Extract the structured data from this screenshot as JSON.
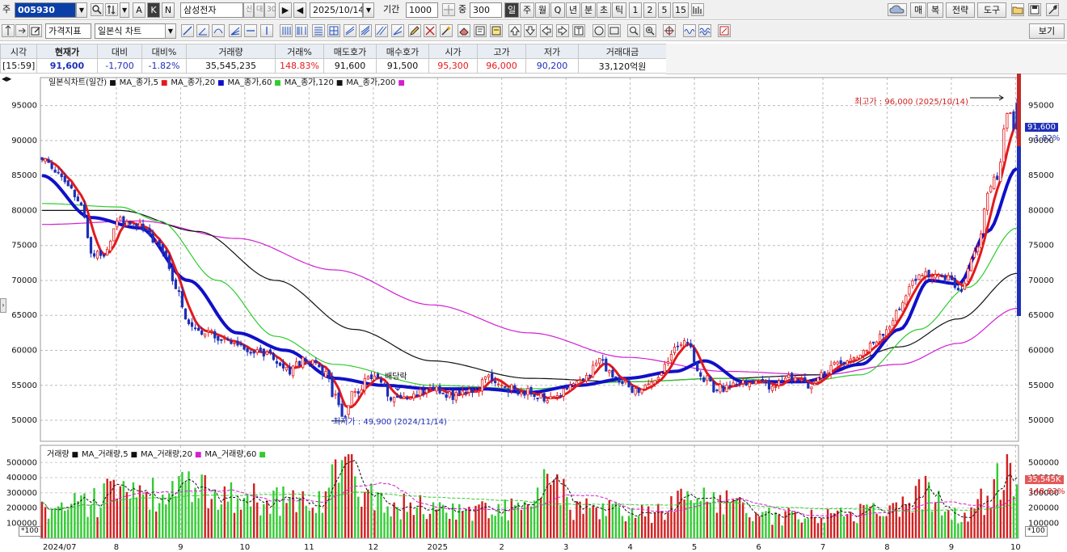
{
  "toolbar1": {
    "market_label": "주",
    "code": "005930",
    "mode_buttons": [
      "A",
      "K",
      "N"
    ],
    "stock_name": "삼성전자",
    "name_tags": [
      "신",
      "대",
      "30"
    ],
    "date": "2025/10/14",
    "period_label": "기간",
    "period_value": "1000",
    "count_label": "중",
    "count_value": "300",
    "interval_buttons": [
      "일",
      "주",
      "월",
      "Q",
      "년",
      "분",
      "초",
      "틱",
      "1",
      "2",
      "5",
      "15"
    ],
    "right_buttons": [
      "매",
      "복",
      "전략",
      "도구"
    ]
  },
  "toolbar2": {
    "indicator_select": "가격지표",
    "chart_type_select": "일본식 차트",
    "view_button": "보기"
  },
  "quote": {
    "headers": [
      "시각",
      "현재가",
      "대비",
      "대비%",
      "거래량",
      "거래%",
      "매도호가",
      "매수호가",
      "시가",
      "고가",
      "저가",
      "거래대금"
    ],
    "values": [
      "[15:59]",
      "91,600",
      "-1,700",
      "-1.82%",
      "35,545,235",
      "148.83%",
      "91,600",
      "91,500",
      "95,300",
      "96,000",
      "90,200",
      "33,120억원"
    ]
  },
  "colors": {
    "up": "#e31a1c",
    "down": "#1f2fb8",
    "ma5": "#e31a1c",
    "ma20": "#1010c8",
    "ma60": "#2ecc2e",
    "ma120": "#111111",
    "ma200": "#d21fd2",
    "vol_up": "#d22020",
    "vol_down": "#33cc33"
  },
  "price_panel": {
    "legend": [
      {
        "label": "일본식차트(일간)",
        "color": "#111111"
      },
      {
        "label": "MA_종가,5",
        "color": "#e31a1c"
      },
      {
        "label": "MA_종가,20",
        "color": "#1010c8"
      },
      {
        "label": "MA_종가,60",
        "color": "#2ecc2e"
      },
      {
        "label": "MA_종가,120",
        "color": "#111111"
      },
      {
        "label": "MA_종가,200",
        "color": "#d21fd2"
      }
    ],
    "high_note": "최고가 : 96,000 (2025/10/14)",
    "low_note": "최저가 : 49,900 (2024/11/14)",
    "dividend_note": "배당락",
    "current_price": "91,600",
    "current_pct": "-1.82%"
  },
  "volume_panel": {
    "legend": [
      {
        "label": "거래량",
        "color": "#111111"
      },
      {
        "label": "MA_거래량,5",
        "color": "#111111"
      },
      {
        "label": "MA_거래량,20",
        "color": "#d21fd2"
      },
      {
        "label": "MA_거래량,60",
        "color": "#2ecc2e"
      }
    ],
    "current_volume": "35,545K",
    "current_pct": "148.83%",
    "scale": "*100"
  },
  "chart_data": [
    {
      "type": "candlestick",
      "title": "일본식차트(일간)",
      "x_labels": [
        "2024/07",
        "8",
        "9",
        "10",
        "11",
        "12",
        "2025",
        "2",
        "3",
        "4",
        "5",
        "6",
        "7",
        "8",
        "9",
        "10"
      ],
      "ylim": [
        47000,
        99000
      ],
      "y_ticks": [
        50000,
        55000,
        60000,
        65000,
        70000,
        75000,
        80000,
        85000,
        90000,
        95000
      ],
      "grid": true,
      "close_keypoints": [
        {
          "t": 0.0,
          "v": 87000
        },
        {
          "t": 0.02,
          "v": 85000
        },
        {
          "t": 0.04,
          "v": 81000
        },
        {
          "t": 0.05,
          "v": 74000
        },
        {
          "t": 0.06,
          "v": 73500
        },
        {
          "t": 0.08,
          "v": 78500
        },
        {
          "t": 0.1,
          "v": 78000
        },
        {
          "t": 0.12,
          "v": 75000
        },
        {
          "t": 0.14,
          "v": 68000
        },
        {
          "t": 0.15,
          "v": 64000
        },
        {
          "t": 0.17,
          "v": 62500
        },
        {
          "t": 0.19,
          "v": 61000
        },
        {
          "t": 0.21,
          "v": 60000
        },
        {
          "t": 0.23,
          "v": 59500
        },
        {
          "t": 0.25,
          "v": 57000
        },
        {
          "t": 0.27,
          "v": 58500
        },
        {
          "t": 0.29,
          "v": 57000
        },
        {
          "t": 0.3,
          "v": 53500
        },
        {
          "t": 0.31,
          "v": 50500
        },
        {
          "t": 0.32,
          "v": 54000
        },
        {
          "t": 0.34,
          "v": 56500
        },
        {
          "t": 0.36,
          "v": 53000
        },
        {
          "t": 0.38,
          "v": 53500
        },
        {
          "t": 0.4,
          "v": 55000
        },
        {
          "t": 0.42,
          "v": 53500
        },
        {
          "t": 0.44,
          "v": 54000
        },
        {
          "t": 0.46,
          "v": 56000
        },
        {
          "t": 0.48,
          "v": 54500
        },
        {
          "t": 0.5,
          "v": 54000
        },
        {
          "t": 0.52,
          "v": 53000
        },
        {
          "t": 0.54,
          "v": 54500
        },
        {
          "t": 0.56,
          "v": 56500
        },
        {
          "t": 0.57,
          "v": 58500
        },
        {
          "t": 0.59,
          "v": 56000
        },
        {
          "t": 0.61,
          "v": 54000
        },
        {
          "t": 0.63,
          "v": 56000
        },
        {
          "t": 0.65,
          "v": 60500
        },
        {
          "t": 0.66,
          "v": 61000
        },
        {
          "t": 0.68,
          "v": 56000
        },
        {
          "t": 0.69,
          "v": 54500
        },
        {
          "t": 0.71,
          "v": 55000
        },
        {
          "t": 0.73,
          "v": 55500
        },
        {
          "t": 0.75,
          "v": 55000
        },
        {
          "t": 0.77,
          "v": 56000
        },
        {
          "t": 0.79,
          "v": 55000
        },
        {
          "t": 0.8,
          "v": 56500
        },
        {
          "t": 0.82,
          "v": 58500
        },
        {
          "t": 0.84,
          "v": 59500
        },
        {
          "t": 0.86,
          "v": 62000
        },
        {
          "t": 0.88,
          "v": 65500
        },
        {
          "t": 0.89,
          "v": 69500
        },
        {
          "t": 0.91,
          "v": 71000
        },
        {
          "t": 0.93,
          "v": 70500
        },
        {
          "t": 0.94,
          "v": 68500
        },
        {
          "t": 0.96,
          "v": 75000
        },
        {
          "t": 0.97,
          "v": 83000
        },
        {
          "t": 0.98,
          "v": 85000
        },
        {
          "t": 0.99,
          "v": 94000
        },
        {
          "t": 1.0,
          "v": 91600
        }
      ],
      "ma20_keypoints": [
        {
          "t": 0.0,
          "v": 85000
        },
        {
          "t": 0.05,
          "v": 79000
        },
        {
          "t": 0.1,
          "v": 77500
        },
        {
          "t": 0.15,
          "v": 70000
        },
        {
          "t": 0.2,
          "v": 62500
        },
        {
          "t": 0.25,
          "v": 60000
        },
        {
          "t": 0.3,
          "v": 56000
        },
        {
          "t": 0.35,
          "v": 55000
        },
        {
          "t": 0.4,
          "v": 54500
        },
        {
          "t": 0.45,
          "v": 54500
        },
        {
          "t": 0.5,
          "v": 54000
        },
        {
          "t": 0.55,
          "v": 55000
        },
        {
          "t": 0.6,
          "v": 56000
        },
        {
          "t": 0.65,
          "v": 57000
        },
        {
          "t": 0.68,
          "v": 58500
        },
        {
          "t": 0.72,
          "v": 55500
        },
        {
          "t": 0.78,
          "v": 55500
        },
        {
          "t": 0.84,
          "v": 58000
        },
        {
          "t": 0.88,
          "v": 63000
        },
        {
          "t": 0.91,
          "v": 70000
        },
        {
          "t": 0.94,
          "v": 69500
        },
        {
          "t": 0.97,
          "v": 77000
        },
        {
          "t": 1.0,
          "v": 86000
        }
      ],
      "ma60_keypoints": [
        {
          "t": 0.0,
          "v": 81000
        },
        {
          "t": 0.08,
          "v": 80500
        },
        {
          "t": 0.12,
          "v": 78500
        },
        {
          "t": 0.18,
          "v": 70000
        },
        {
          "t": 0.24,
          "v": 62000
        },
        {
          "t": 0.3,
          "v": 58000
        },
        {
          "t": 0.4,
          "v": 55000
        },
        {
          "t": 0.5,
          "v": 54500
        },
        {
          "t": 0.6,
          "v": 55500
        },
        {
          "t": 0.7,
          "v": 56000
        },
        {
          "t": 0.78,
          "v": 55500
        },
        {
          "t": 0.84,
          "v": 56500
        },
        {
          "t": 0.9,
          "v": 63000
        },
        {
          "t": 0.95,
          "v": 69000
        },
        {
          "t": 1.0,
          "v": 77500
        }
      ],
      "ma120_keypoints": [
        {
          "t": 0.0,
          "v": 80000
        },
        {
          "t": 0.08,
          "v": 80000
        },
        {
          "t": 0.16,
          "v": 77000
        },
        {
          "t": 0.24,
          "v": 70000
        },
        {
          "t": 0.32,
          "v": 63000
        },
        {
          "t": 0.4,
          "v": 58500
        },
        {
          "t": 0.5,
          "v": 56000
        },
        {
          "t": 0.6,
          "v": 55500
        },
        {
          "t": 0.7,
          "v": 56000
        },
        {
          "t": 0.8,
          "v": 56500
        },
        {
          "t": 0.88,
          "v": 60500
        },
        {
          "t": 0.94,
          "v": 64500
        },
        {
          "t": 1.0,
          "v": 71000
        }
      ],
      "ma200_keypoints": [
        {
          "t": 0.0,
          "v": 78000
        },
        {
          "t": 0.1,
          "v": 78500
        },
        {
          "t": 0.2,
          "v": 76000
        },
        {
          "t": 0.3,
          "v": 71500
        },
        {
          "t": 0.4,
          "v": 66500
        },
        {
          "t": 0.5,
          "v": 62500
        },
        {
          "t": 0.6,
          "v": 59000
        },
        {
          "t": 0.7,
          "v": 57000
        },
        {
          "t": 0.8,
          "v": 56500
        },
        {
          "t": 0.88,
          "v": 58000
        },
        {
          "t": 0.94,
          "v": 61000
        },
        {
          "t": 1.0,
          "v": 66000
        }
      ]
    },
    {
      "type": "bar",
      "title": "거래량",
      "unit": "*100",
      "ylim": [
        0,
        560000
      ],
      "y_ticks": [
        100000,
        200000,
        300000,
        400000,
        500000
      ],
      "volume_keypoints": [
        {
          "t": 0.0,
          "v": 200000
        },
        {
          "t": 0.06,
          "v": 250000
        },
        {
          "t": 0.07,
          "v": 520000
        },
        {
          "t": 0.09,
          "v": 280000
        },
        {
          "t": 0.15,
          "v": 340000
        },
        {
          "t": 0.22,
          "v": 270000
        },
        {
          "t": 0.28,
          "v": 260000
        },
        {
          "t": 0.31,
          "v": 480000
        },
        {
          "t": 0.35,
          "v": 230000
        },
        {
          "t": 0.45,
          "v": 190000
        },
        {
          "t": 0.5,
          "v": 210000
        },
        {
          "t": 0.52,
          "v": 390000
        },
        {
          "t": 0.55,
          "v": 200000
        },
        {
          "t": 0.62,
          "v": 170000
        },
        {
          "t": 0.68,
          "v": 300000
        },
        {
          "t": 0.75,
          "v": 150000
        },
        {
          "t": 0.82,
          "v": 170000
        },
        {
          "t": 0.88,
          "v": 210000
        },
        {
          "t": 0.9,
          "v": 330000
        },
        {
          "t": 0.94,
          "v": 150000
        },
        {
          "t": 0.97,
          "v": 260000
        },
        {
          "t": 0.99,
          "v": 500000
        },
        {
          "t": 1.0,
          "v": 355450
        }
      ]
    }
  ]
}
